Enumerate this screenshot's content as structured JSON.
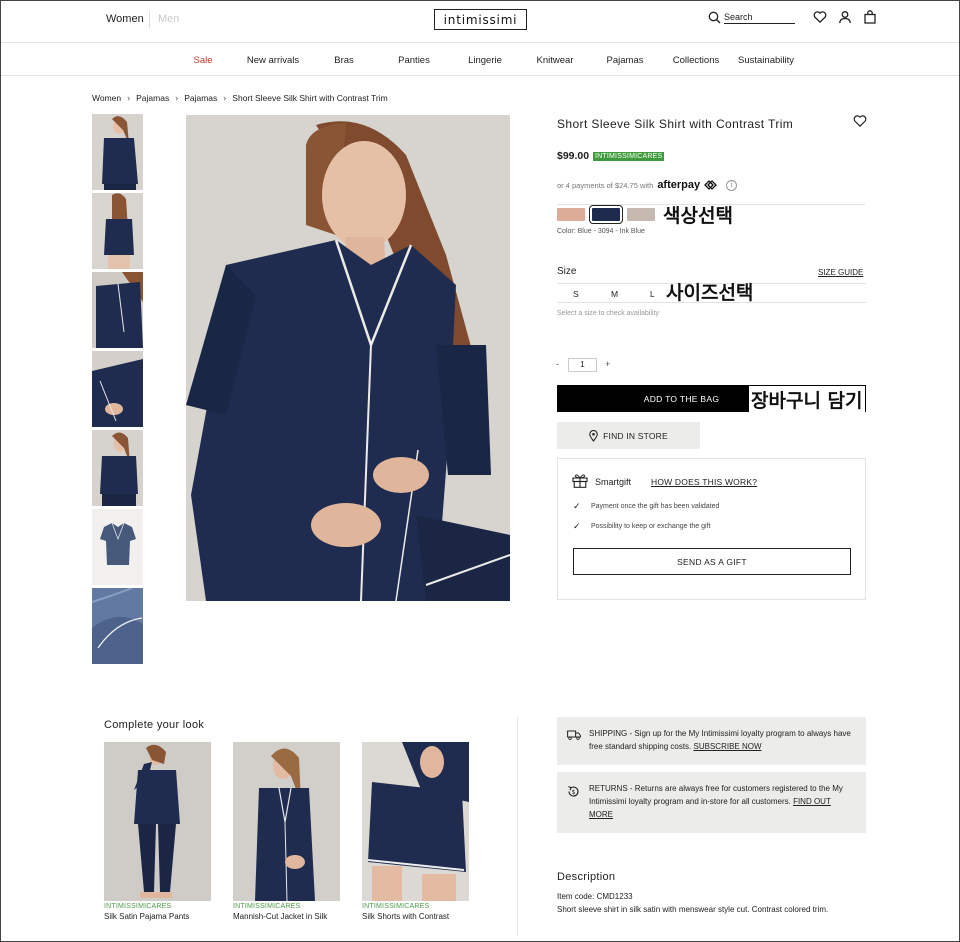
{
  "header": {
    "women": "Women",
    "men": "Men",
    "logo": "intimissimi",
    "search_placeholder": "Search"
  },
  "nav": {
    "items": [
      "Sale",
      "New arrivals",
      "Bras",
      "Panties",
      "Lingerie",
      "Knitwear",
      "Pajamas",
      "Collections",
      "Sustainability"
    ]
  },
  "breadcrumb": [
    "Women",
    "Pajamas",
    "Pajamas",
    "Short Sleeve Silk Shirt with Contrast Trim"
  ],
  "product": {
    "title": "Short Sleeve Silk Shirt with Contrast Trim",
    "price": "$99.00",
    "badge": "INTIMISSIMICARES",
    "afterpay_text": "or 4 payments of $24.75 with",
    "afterpay_logo": "afterpay",
    "info_icon": "i",
    "color_label": "Color: Blue - 3094 - Ink Blue",
    "swatches": [
      {
        "color": "#dcac98",
        "selected": false
      },
      {
        "color": "#1d2a4d",
        "selected": true
      },
      {
        "color": "#c6b9b2",
        "selected": false
      }
    ],
    "annotation_color": "색상선택",
    "size_heading": "Size",
    "size_guide": "SIZE GUIDE",
    "sizes": [
      "S",
      "M",
      "L"
    ],
    "annotation_size": "사이즈선택",
    "size_hint": "Select a size to check availability",
    "qty_minus": "-",
    "qty": "1",
    "qty_plus": "+",
    "add_to_bag": "ADD TO THE BAG",
    "annotation_bag": "장바구니 담기",
    "find_in_store": "FIND IN STORE"
  },
  "gift": {
    "title": "Smartgift",
    "how": "HOW DOES THIS WORK?",
    "lines": [
      "Payment once the gift has been validated",
      "Possibility to keep or exchange the gift"
    ],
    "send": "SEND AS A GIFT"
  },
  "look": {
    "title": "Complete your look",
    "items": [
      {
        "brand": "INTIMISSIMICARES",
        "name": "Silk Satin Pajama Pants"
      },
      {
        "brand": "INTIMISSIMICARES",
        "name": "Mannish-Cut Jacket in Silk"
      },
      {
        "brand": "INTIMISSIMICARES",
        "name": "Silk Shorts with Contrast"
      }
    ]
  },
  "shipping": {
    "label": "SHIPPING",
    "text": " - Sign up for the My Intimissimi loyalty program to always have free standard shipping costs. ",
    "link": "SUBSCRIBE NOW"
  },
  "returns": {
    "label": "RETURNS",
    "text": " - Returns are always free for customers registered to the My Intimissimi loyalty program and in-store for all customers. ",
    "link": "FIND OUT MORE"
  },
  "description": {
    "title": "Description",
    "code": "Item code: CMD1233",
    "text": "Short sleeve shirt in silk satin with menswear style cut. Contrast colored trim."
  },
  "colors": {
    "sale": "#c0392b",
    "badge": "#3f9b3c",
    "silk_navy": "#1d2a4d"
  }
}
